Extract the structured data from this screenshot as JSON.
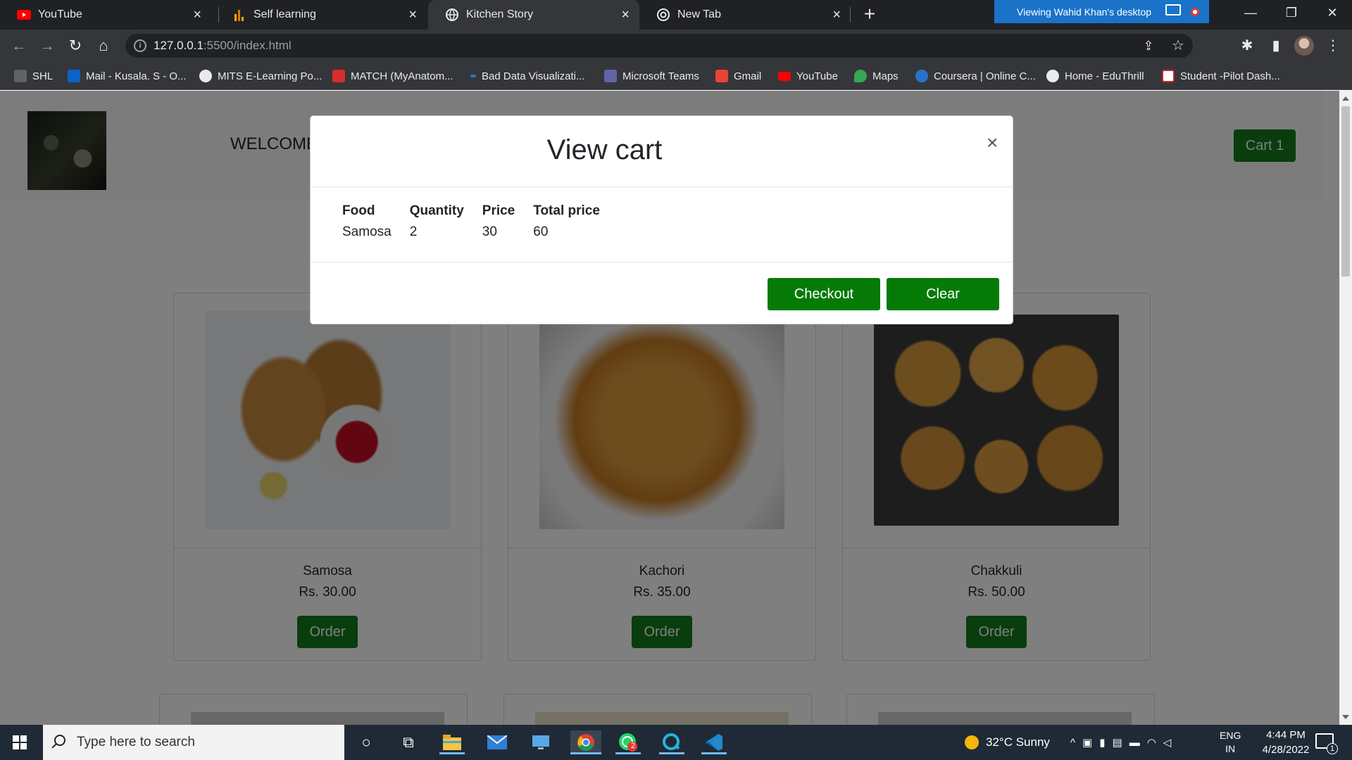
{
  "browser": {
    "tabs": [
      {
        "title": "YouTube",
        "icon": "youtube-icon"
      },
      {
        "title": "Self learning",
        "icon": "analytics-icon"
      },
      {
        "title": "Kitchen Story",
        "icon": "globe-icon",
        "active": true
      },
      {
        "title": "New Tab",
        "icon": "chrome-icon"
      }
    ],
    "remote_banner": "Viewing Wahid Khan's desktop",
    "url_host": "127.0.0.1",
    "url_path": ":5500/index.html",
    "bookmarks": [
      {
        "label": "SHL",
        "icon": "shl-icon",
        "color": "#5f6368"
      },
      {
        "label": "Mail - Kusala. S - O...",
        "icon": "outlook-icon",
        "color": "#0a64c8"
      },
      {
        "label": "MITS E-Learning Po...",
        "icon": "globe-icon",
        "color": "#e8eaed"
      },
      {
        "label": "MATCH (MyAnatom...",
        "icon": "match-icon",
        "color": "#d92c2c"
      },
      {
        "label": "Bad Data Visualizati...",
        "icon": "doc-icon",
        "color": "#2f6fd1"
      },
      {
        "label": "Microsoft Teams",
        "icon": "teams-icon",
        "color": "#6264a7"
      },
      {
        "label": "Gmail",
        "icon": "gmail-icon",
        "color": "#ea4335"
      },
      {
        "label": "YouTube",
        "icon": "youtube-icon",
        "color": "#ff0000"
      },
      {
        "label": "Maps",
        "icon": "maps-icon",
        "color": "#34a853"
      },
      {
        "label": "Coursera | Online C...",
        "icon": "coursera-icon",
        "color": "#2a73cc"
      },
      {
        "label": "Home - EduThrill",
        "icon": "eduthrill-icon",
        "color": "#e8eaed"
      },
      {
        "label": "Student -Pilot Dash...",
        "icon": "student-icon",
        "color": "#ffffff"
      }
    ]
  },
  "page": {
    "welcome": "WELCOME",
    "cart_button": "Cart 1",
    "products": [
      {
        "name": "Samosa",
        "price": "Rs. 30.00",
        "order": "Order"
      },
      {
        "name": "Kachori",
        "price": "Rs. 35.00",
        "order": "Order"
      },
      {
        "name": "Chakkuli",
        "price": "Rs. 50.00",
        "order": "Order"
      }
    ]
  },
  "modal": {
    "title": "View cart",
    "close": "×",
    "headers": [
      "Food",
      "Quantity",
      "Price",
      "Total price"
    ],
    "rows": [
      [
        "Samosa",
        "2",
        "30",
        "60"
      ]
    ],
    "checkout": "Checkout",
    "clear": "Clear"
  },
  "taskbar": {
    "search_placeholder": "Type here to search",
    "weather": "32°C  Sunny",
    "lang_line1": "ENG",
    "lang_line2": "IN",
    "time": "4:44 PM",
    "date": "4/28/2022",
    "whatsapp_badge": "2",
    "notification_count": "1"
  },
  "colors": {
    "accent_green": "#137a1b",
    "modal_button_green": "#067a06",
    "chrome_dark": "#202124",
    "remote_banner_blue": "#1a73c8"
  }
}
